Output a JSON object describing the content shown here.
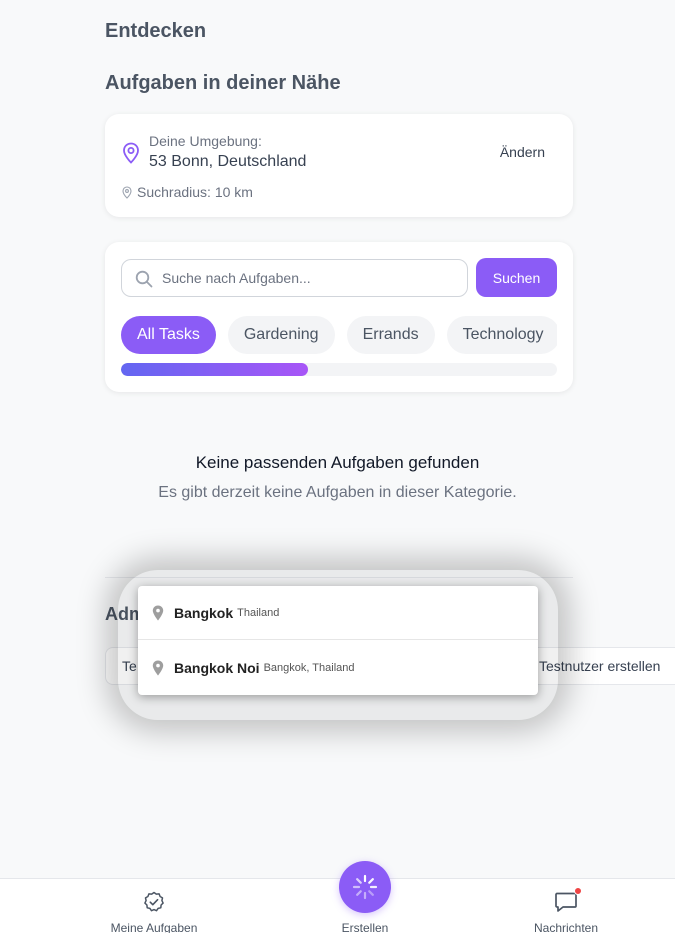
{
  "header": {
    "title": "Entdecken"
  },
  "nearby": {
    "title": "Aufgaben in deiner Nähe",
    "location_label": "Deine Umgebung:",
    "location_value": "53 Bonn, Deutschland",
    "change_label": "Ändern",
    "radius_text": "Suchradius: 10 km"
  },
  "search": {
    "placeholder": "Suche nach Aufgaben...",
    "button_label": "Suchen",
    "categories": [
      "All Tasks",
      "Gardening",
      "Errands",
      "Technology"
    ],
    "active_category": "All Tasks",
    "scroll_progress": 0.43
  },
  "empty_state": {
    "title": "Keine passenden Aufgaben gefunden",
    "subtitle": "Es gibt derzeit keine Aufgaben in dieser Kategorie."
  },
  "admin": {
    "title": "Adm",
    "input_value": "Te",
    "button_label": "Testnutzer erstellen"
  },
  "suggestions": [
    {
      "main": "Bangkok",
      "secondary": "Thailand"
    },
    {
      "main": "Bangkok Noi",
      "secondary": "Bangkok, Thailand"
    }
  ],
  "bottom_nav": {
    "tasks_label": "Meine Aufgaben",
    "create_label": "Erstellen",
    "messages_label": "Nachrichten"
  },
  "colors": {
    "accent": "#8b5cf6",
    "badge": "#ef4444"
  }
}
